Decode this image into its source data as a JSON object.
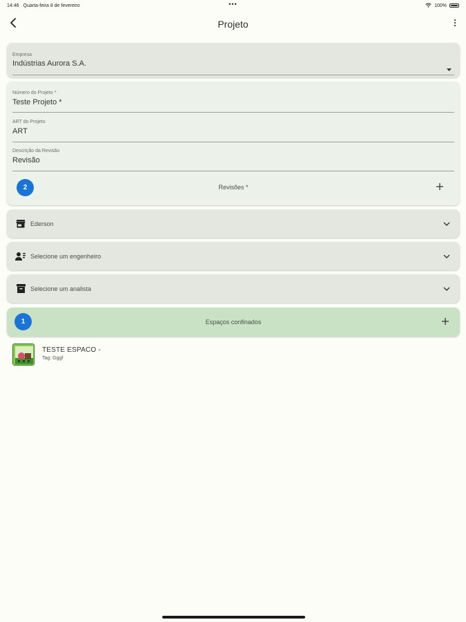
{
  "status_bar": {
    "time": "14:46",
    "date": "Quarta-feira 8 de fevereiro",
    "dots": "•••",
    "battery": "100%"
  },
  "app_bar": {
    "title": "Projeto",
    "back_icon": "chevron-left-icon",
    "menu_icon": "more-vert-icon"
  },
  "company": {
    "label": "Empresa",
    "value": "Indústrias Aurora S.A."
  },
  "project_form": {
    "number_label": "Número do Projeto *",
    "number_value": "Teste Projeto *",
    "art_label": "ART do Projeto",
    "art_value": "ART",
    "revision_desc_label": "Descrição da Revisão",
    "revision_desc_value": "Revisão",
    "revisions_count": "2",
    "revisions_label": "Revisões *"
  },
  "dropdowns": [
    {
      "label": "Ederson",
      "icon": "store-icon"
    },
    {
      "label": "Selecione um engenheiro",
      "icon": "engineer-icon"
    },
    {
      "label": "Selecione um analista",
      "icon": "archive-icon"
    }
  ],
  "spaces": {
    "count": "1",
    "label": "Espaços confinados"
  },
  "space_items": [
    {
      "title": "TESTE ESPACO -",
      "tag": "Tag: Gggf"
    }
  ],
  "colors": {
    "accent_blue": "#1a73d6",
    "card_bg": "#e3e7df",
    "space_card_bg": "#c9e2c6",
    "page_bg": "#fcfdf7"
  }
}
